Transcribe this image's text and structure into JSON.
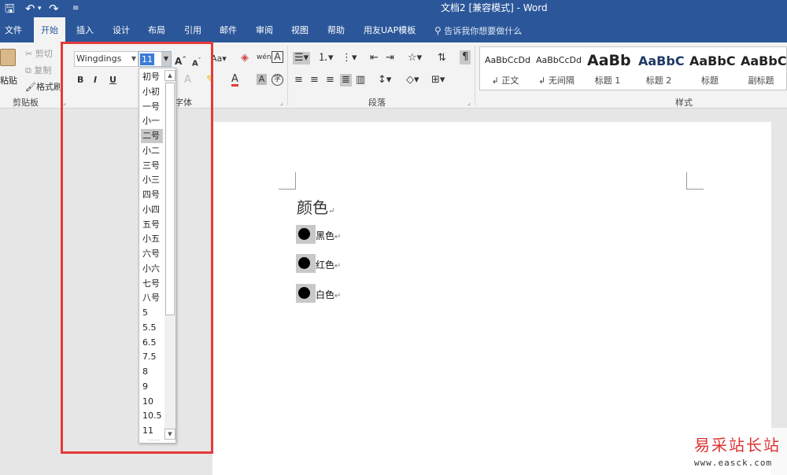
{
  "title_bar": {
    "save_icon": "save-icon",
    "undo_icon": "undo-icon",
    "redo_icon": "redo-icon",
    "customize_icon": "customize-qat-icon",
    "doc_title": "文档2 [兼容模式]  -  Word"
  },
  "tabs": [
    {
      "label": "文件"
    },
    {
      "label": "开始"
    },
    {
      "label": "插入"
    },
    {
      "label": "设计"
    },
    {
      "label": "布局"
    },
    {
      "label": "引用"
    },
    {
      "label": "邮件"
    },
    {
      "label": "审阅"
    },
    {
      "label": "视图"
    },
    {
      "label": "帮助"
    },
    {
      "label": "用友UAP模板"
    }
  ],
  "active_tab": "开始",
  "tell_me": "告诉我你想要做什么",
  "clipboard": {
    "paste": "粘贴",
    "cut": "剪切",
    "copy": "复制",
    "format_painter": "格式刷",
    "group_label": "剪贴板"
  },
  "font": {
    "name": "Wingdings",
    "size": "11",
    "group_label": "字体",
    "bold": "B",
    "italic": "I",
    "underline": "U",
    "grow": "A",
    "shrink": "A",
    "case": "Aa",
    "color_letter": "A",
    "char_border": "A",
    "enclose": "字"
  },
  "paragraph": {
    "group_label": "段落"
  },
  "styles": {
    "group_label": "样式",
    "items": [
      {
        "sample": "AaBbCcDd",
        "name": "↲ 正文"
      },
      {
        "sample": "AaBbCcDd",
        "name": "↲ 无间隔"
      },
      {
        "sample": "AaBb",
        "name": "标题 1"
      },
      {
        "sample": "AaBbC",
        "name": "标题 2"
      },
      {
        "sample": "AaBbC",
        "name": "标题"
      },
      {
        "sample": "AaBbC",
        "name": "副标题"
      }
    ]
  },
  "font_size_dropdown": {
    "items": [
      "初号",
      "小初",
      "一号",
      "小一",
      "二号",
      "小二",
      "三号",
      "小三",
      "四号",
      "小四",
      "五号",
      "小五",
      "六号",
      "小六",
      "七号",
      "八号",
      "5",
      "5.5",
      "6.5",
      "7.5",
      "8",
      "9",
      "10",
      "10.5",
      "11"
    ],
    "selected": "二号"
  },
  "document": {
    "heading": "颜色",
    "para_mark": "↵",
    "bullets": [
      {
        "text": "黑色"
      },
      {
        "text": "红色"
      },
      {
        "text": "白色"
      }
    ]
  },
  "colors": {
    "title_bar": "#2b579a",
    "highlight_border": "#e53a3a",
    "selected_item": "#c8c8c8"
  },
  "watermark": {
    "title": "易采站长站",
    "url": "www.easck.com"
  }
}
